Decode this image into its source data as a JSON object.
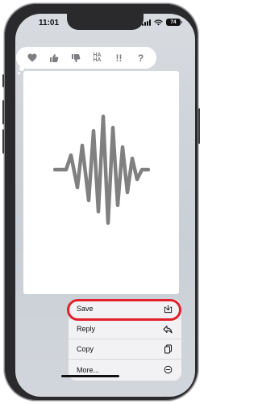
{
  "status_bar": {
    "time": "11:01",
    "battery_level": "74"
  },
  "tapback": {
    "reactions": [
      {
        "icon": "heart-icon"
      },
      {
        "icon": "thumbs-up-icon"
      },
      {
        "icon": "thumbs-down-icon"
      },
      {
        "icon": "haha-icon",
        "text": "HA HA"
      },
      {
        "icon": "double-exclamation-icon",
        "text": "!!"
      },
      {
        "icon": "question-mark-icon",
        "text": "?"
      }
    ]
  },
  "message": {
    "content_icon": "audio-waveform-icon"
  },
  "context_menu": {
    "items": [
      {
        "label": "Save",
        "icon": "save-download-icon",
        "highlighted": true
      },
      {
        "label": "Reply",
        "icon": "reply-arrow-icon"
      },
      {
        "label": "Copy",
        "icon": "copy-icon"
      },
      {
        "label": "More...",
        "icon": "more-circle-icon"
      }
    ]
  },
  "colors": {
    "highlight": "#e0202b",
    "icon_gray": "#7d7d82",
    "waveform": "#808080"
  }
}
